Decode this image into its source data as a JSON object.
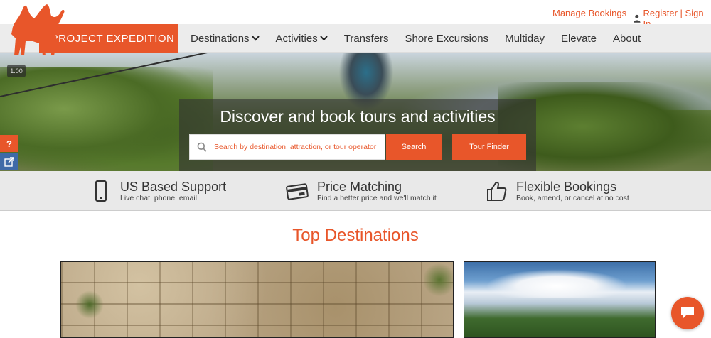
{
  "topbar": {
    "manage_bookings": "Manage Bookings",
    "register_signin": "Register | Sign In"
  },
  "brand": {
    "name": "PROJECT EXPEDITION",
    "accent_color": "#e8562a"
  },
  "nav": {
    "items": [
      {
        "label": "Destinations",
        "has_dropdown": true
      },
      {
        "label": "Activities",
        "has_dropdown": true
      },
      {
        "label": "Transfers",
        "has_dropdown": false
      },
      {
        "label": "Shore Excursions",
        "has_dropdown": false
      },
      {
        "label": "Multiday",
        "has_dropdown": false
      },
      {
        "label": "Elevate",
        "has_dropdown": false
      },
      {
        "label": "About",
        "has_dropdown": false
      }
    ]
  },
  "hero": {
    "video_time": "1:00",
    "title": "Discover and book tours and activities",
    "search_placeholder": "Search by destination, attraction, or tour operator",
    "search_button": "Search",
    "tour_finder_button": "Tour Finder"
  },
  "side": {
    "help_label": "?"
  },
  "features": [
    {
      "icon": "phone-icon",
      "title": "US Based Support",
      "subtitle": "Live chat, phone, email"
    },
    {
      "icon": "credit-card-icon",
      "title": "Price Matching",
      "subtitle": "Find a better price and we'll match it"
    },
    {
      "icon": "thumbs-up-icon",
      "title": "Flexible Bookings",
      "subtitle": "Book, amend, or cancel at no cost"
    }
  ],
  "destinations": {
    "title": "Top Destinations"
  }
}
